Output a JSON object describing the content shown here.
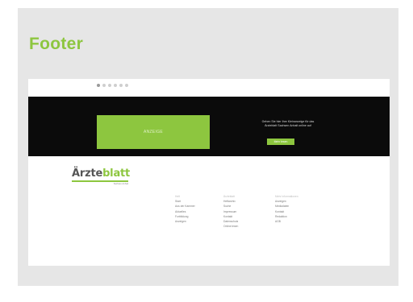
{
  "slide": {
    "title": "Footer"
  },
  "mockup": {
    "slider_dots": 6,
    "active_dot": 0,
    "banner": {
      "ad_label": "ANZEIGE",
      "text_line1": "Gehen Sie hier Ihre Kleinanzeige für das",
      "text_line2": "Ärzteblatt Sachsen Anhalt online auf",
      "button_label": "Mehr lesen"
    },
    "logo": {
      "text_dark": "Ärzte",
      "text_green": "blatt",
      "subtitle": "Sachsen-Anhalt"
    },
    "footer_columns": [
      {
        "heading": "Heft",
        "items": [
          "Start",
          "Aus der Kammer",
          "Aktuelles",
          "Fortbildung",
          "Anzeigen"
        ]
      },
      {
        "heading": "Ärzteblatt",
        "items": [
          "Heftarchiv",
          "Suche",
          "Impressum",
          "Kontakt",
          "Datenschutz",
          "Online lesen"
        ]
      },
      {
        "heading": "Mehr Informationen",
        "items": [
          "Anzeigen",
          "Mediadaten",
          "Kontakt",
          "Redaktion",
          "AGB"
        ]
      }
    ]
  },
  "colors": {
    "accent": "#8dc63f",
    "slide_background": "#e6e6e6",
    "banner_background": "#0b0b0b"
  }
}
